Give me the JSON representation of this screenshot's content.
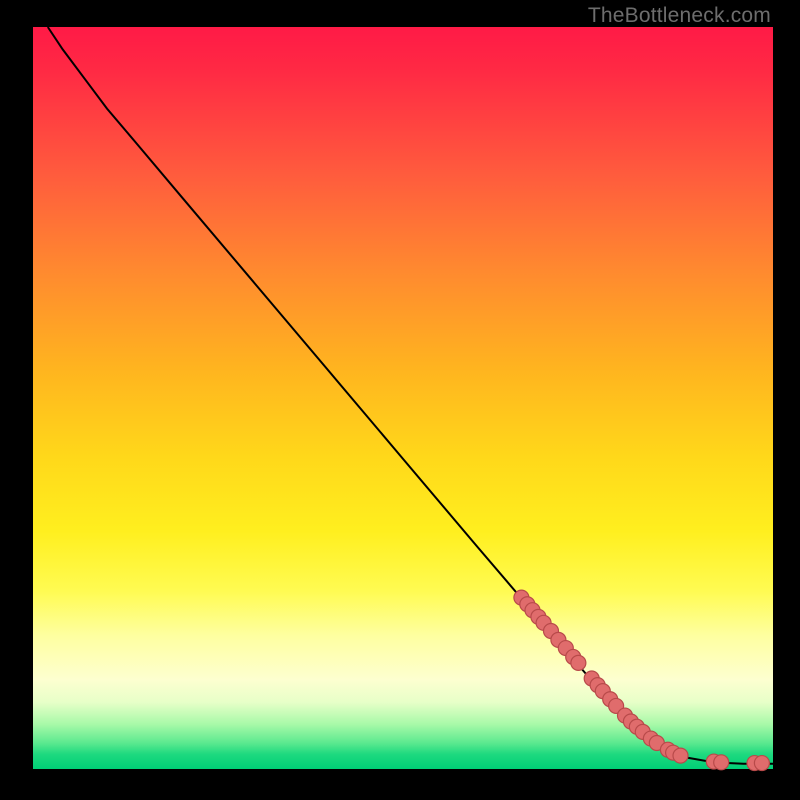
{
  "watermark": "TheBottleneck.com",
  "colors": {
    "dot_fill": "#e06c6c",
    "dot_stroke": "#b84a4a",
    "curve": "#000000"
  },
  "chart_data": {
    "type": "line",
    "title": "",
    "xlabel": "",
    "ylabel": "",
    "xlim": [
      0,
      100
    ],
    "ylim": [
      0,
      100
    ],
    "curve_xy": [
      [
        2,
        100
      ],
      [
        4,
        97
      ],
      [
        7,
        93
      ],
      [
        10,
        89
      ],
      [
        14,
        84.3
      ],
      [
        20,
        77.2
      ],
      [
        30,
        65.4
      ],
      [
        40,
        53.6
      ],
      [
        50,
        41.8
      ],
      [
        60,
        30.0
      ],
      [
        66,
        23.0
      ],
      [
        70,
        18.3
      ],
      [
        75,
        12.5
      ],
      [
        80,
        7.0
      ],
      [
        85,
        3.1
      ],
      [
        88,
        1.6
      ],
      [
        92,
        0.9
      ],
      [
        96,
        0.7
      ],
      [
        100,
        0.7
      ]
    ],
    "points_xy": [
      [
        66.0,
        23.1
      ],
      [
        66.8,
        22.2
      ],
      [
        67.5,
        21.4
      ],
      [
        68.3,
        20.5
      ],
      [
        69.0,
        19.7
      ],
      [
        70.0,
        18.6
      ],
      [
        71.0,
        17.4
      ],
      [
        72.0,
        16.3
      ],
      [
        73.0,
        15.1
      ],
      [
        73.7,
        14.3
      ],
      [
        75.5,
        12.2
      ],
      [
        76.3,
        11.3
      ],
      [
        77.0,
        10.5
      ],
      [
        78.0,
        9.4
      ],
      [
        78.8,
        8.5
      ],
      [
        80.0,
        7.2
      ],
      [
        80.8,
        6.4
      ],
      [
        81.6,
        5.7
      ],
      [
        82.4,
        5.0
      ],
      [
        83.5,
        4.1
      ],
      [
        84.3,
        3.5
      ],
      [
        85.8,
        2.6
      ],
      [
        86.5,
        2.2
      ],
      [
        87.5,
        1.8
      ],
      [
        92.0,
        1.0
      ],
      [
        93.0,
        0.9
      ],
      [
        97.5,
        0.8
      ],
      [
        98.5,
        0.8
      ]
    ]
  }
}
